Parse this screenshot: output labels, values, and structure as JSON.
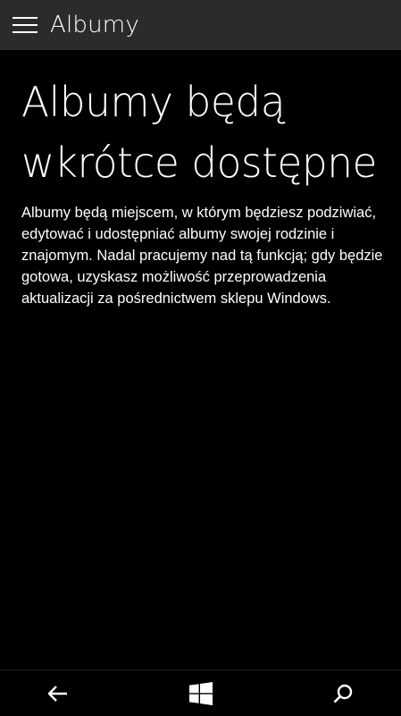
{
  "app_bar": {
    "title": "Albumy",
    "menu_icon": "hamburger-menu-icon",
    "background": "#2b2b2b"
  },
  "main": {
    "heading": "Albumy będą\nwkrótce dostępne",
    "body": "Albumy będą miejscem, w którym będziesz podziwiać, edytować i udostępniać albumy swojej rodzinie i znajomym. Nadal pracujemy nad tą funkcją; gdy będzie gotowa, uzyskasz możliwość przeprowadzenia aktualizacji za pośrednictwem sklepu Windows."
  },
  "nav_bar": {
    "back_icon": "back-arrow-icon",
    "start_icon": "windows-logo-icon",
    "search_icon": "search-icon"
  },
  "colors": {
    "background": "#000000",
    "text": "#ffffff"
  }
}
